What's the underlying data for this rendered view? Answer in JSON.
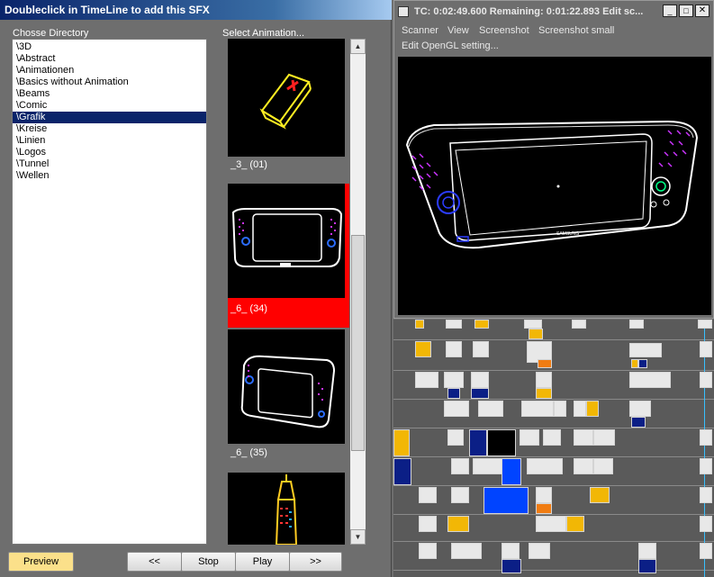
{
  "sfx_window": {
    "title": "Doubleclick in TimeLine to add this SFX",
    "choose_directory_label": "Chosse Directory",
    "select_animation_label": "Select Animation...",
    "directories": [
      "\\3D",
      "\\Abstract",
      "\\Animationen",
      "\\Basics without Animation",
      "\\Beams",
      "\\Comic",
      "\\Grafik",
      "\\Kreise",
      "\\Linien",
      "\\Logos",
      "\\Tunnel",
      "\\Wellen"
    ],
    "selected_directory": "\\Grafik",
    "animations": [
      {
        "caption": "_3_ (01)",
        "selected": false
      },
      {
        "caption": "_6_ (34)",
        "selected": true
      },
      {
        "caption": "_6_ (35)",
        "selected": false
      }
    ],
    "buttons": {
      "preview": "Preview",
      "rewind": "<<",
      "stop": "Stop",
      "play": "Play",
      "forward": ">>"
    }
  },
  "scanner_window": {
    "title": "TC: 0:02:49.600  Remaining: 0:01:22.893  Edit sc...",
    "menu": [
      "Scanner",
      "View",
      "Screenshot",
      "Screenshot small"
    ],
    "menu2": "Edit OpenGL setting...",
    "device_brand": "SAMSUNG"
  },
  "colors": {
    "title_bar": "#0a246a",
    "selection": "#0a246a",
    "selected_thumb": "#ff0000",
    "preview_button": "#fbe08a"
  }
}
